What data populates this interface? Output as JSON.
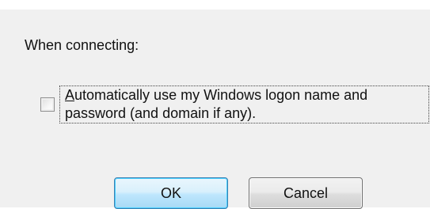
{
  "dialog": {
    "heading": "When connecting:",
    "auto_logon": {
      "checked": false,
      "label_mnemonic": "A",
      "label_line1_rest": "utomatically use my Windows logon name and",
      "label_line2": "password (and domain if any)."
    },
    "buttons": {
      "ok_label": "OK",
      "cancel_label": "Cancel"
    }
  },
  "colors": {
    "dialog_background": "#f0f0f0",
    "ok_button_border": "#3c7fb1",
    "focus_rect": "#444444"
  }
}
